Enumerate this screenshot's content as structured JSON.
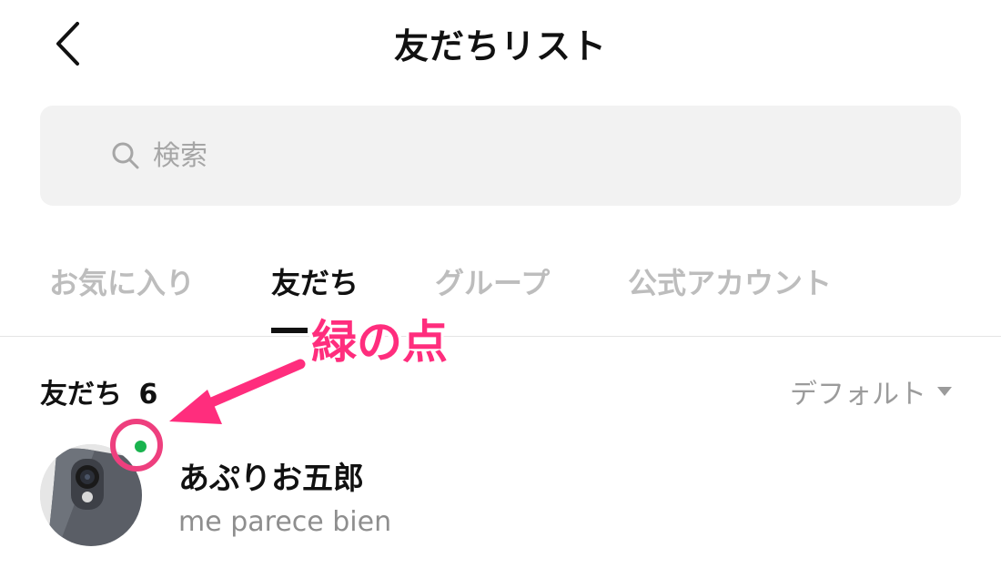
{
  "header": {
    "title": "友だちリスト",
    "back_icon": "chevron-left-icon"
  },
  "search": {
    "placeholder": "検索",
    "value": "",
    "icon": "search-icon"
  },
  "tabs": [
    {
      "label": "お気に入り",
      "active": false
    },
    {
      "label": "友だち",
      "active": true
    },
    {
      "label": "グループ",
      "active": false
    },
    {
      "label": "公式アカウント",
      "active": false
    }
  ],
  "friends_section": {
    "label": "友だち",
    "count": "6",
    "sort_label": "デフォルト"
  },
  "friends": [
    {
      "name": "あぷりお五郎",
      "status": "me parece bien",
      "online": true
    }
  ],
  "annotation": {
    "label": "緑の点",
    "color": "#ff2d7d"
  },
  "colors": {
    "online": "#19b34e",
    "inactive_tab": "#bdbdbd",
    "annotation": "#ff2d7d"
  }
}
